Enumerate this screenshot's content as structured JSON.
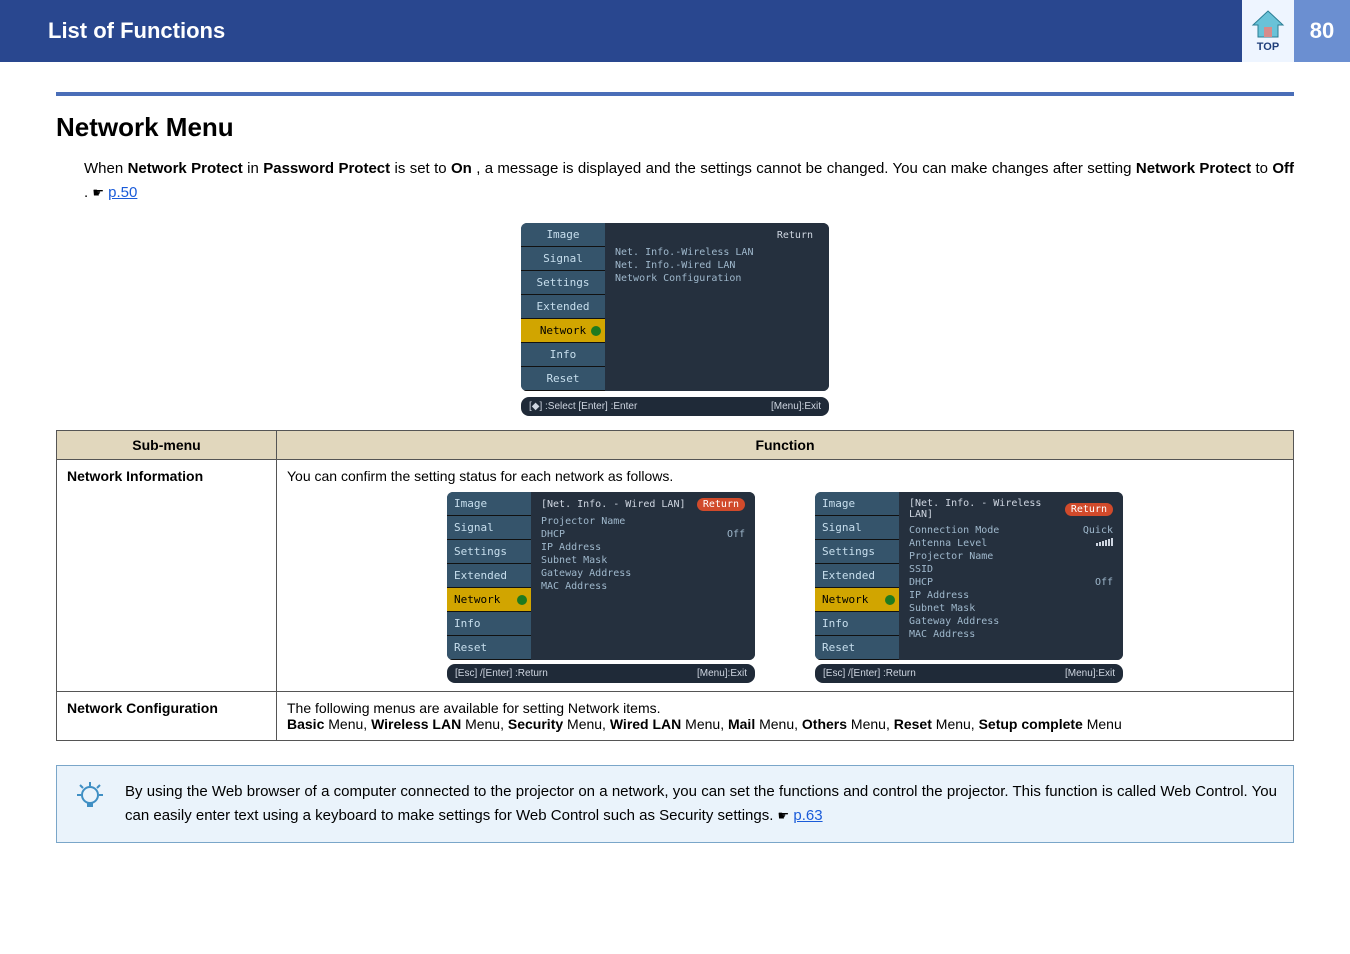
{
  "header": {
    "title": "List of Functions",
    "top_label": "TOP",
    "page_number": "80"
  },
  "section_heading": "Network Menu",
  "intro": {
    "prefix": "When ",
    "np": "Network Protect",
    "in_word": " in ",
    "pp": "Password Protect",
    "set_to": " is set to ",
    "on": "On",
    "mid": ", a message is displayed and the settings cannot be changed. You can make changes after setting ",
    "np2": "Network Protect",
    "to_word": " to ",
    "off": "Off",
    "dot": ". ",
    "ptr": "☛",
    "link": "p.50"
  },
  "menu_main": {
    "left": [
      "Image",
      "Signal",
      "Settings",
      "Extended",
      "Network",
      "Info",
      "Reset"
    ],
    "right_items": [
      "Net. Info.-Wireless LAN",
      "Net. Info.-Wired LAN",
      "Network Configuration"
    ],
    "return": "Return",
    "foot_left": "[◆] :Select  [Enter] :Enter",
    "foot_right": "[Menu]:Exit"
  },
  "table": {
    "headers": {
      "sub": "Sub-menu",
      "func": "Function"
    },
    "row1": {
      "sub": "Network Information",
      "desc": "You can confirm the setting status for each network as follows.",
      "wired": {
        "title": "[Net. Info. - Wired LAN]",
        "return": "Return",
        "rows": [
          {
            "l": "Projector Name",
            "r": ""
          },
          {
            "l": "DHCP",
            "r": "Off"
          },
          {
            "l": "IP Address",
            "r": ""
          },
          {
            "l": "Subnet Mask",
            "r": ""
          },
          {
            "l": "Gateway Address",
            "r": ""
          },
          {
            "l": "MAC Address",
            "r": ""
          }
        ],
        "foot_left": "[Esc] /[Enter] :Return",
        "foot_right": "[Menu]:Exit"
      },
      "wireless": {
        "title": "[Net. Info. - Wireless LAN]",
        "return": "Return",
        "rows": [
          {
            "l": "Connection Mode",
            "r": "Quick"
          },
          {
            "l": "Antenna Level",
            "r": "__bars__"
          },
          {
            "l": "Projector Name",
            "r": ""
          },
          {
            "l": "SSID",
            "r": ""
          },
          {
            "l": "DHCP",
            "r": "Off"
          },
          {
            "l": "IP Address",
            "r": ""
          },
          {
            "l": "Subnet Mask",
            "r": ""
          },
          {
            "l": "Gateway Address",
            "r": ""
          },
          {
            "l": "MAC Address",
            "r": ""
          }
        ],
        "foot_left": "[Esc] /[Enter] :Return",
        "foot_right": "[Menu]:Exit"
      }
    },
    "row2": {
      "sub": "Network Configuration",
      "line1": "The following menus are available for setting Network items.",
      "line2": {
        "b1": "Basic",
        "t1": " Menu, ",
        "b2": "Wireless LAN",
        "t2": " Menu, ",
        "b3": "Security",
        "t3": " Menu, ",
        "b4": "Wired LAN",
        "t4": " Menu, ",
        "b5": "Mail",
        "t5": " Menu, ",
        "b6": "Others",
        "t6": " Menu, ",
        "b7": "Reset",
        "t7": " Menu, ",
        "b8": "Setup complete",
        "t8": " Menu"
      }
    }
  },
  "tip": {
    "text_pre": "By using the Web browser of a computer connected to the projector on a network, you can set the functions and control the projector. This function is called Web Control. You can easily enter text using a keyboard to make settings for Web Control such as Security settings. ",
    "ptr": "☛",
    "link": "p.63"
  }
}
